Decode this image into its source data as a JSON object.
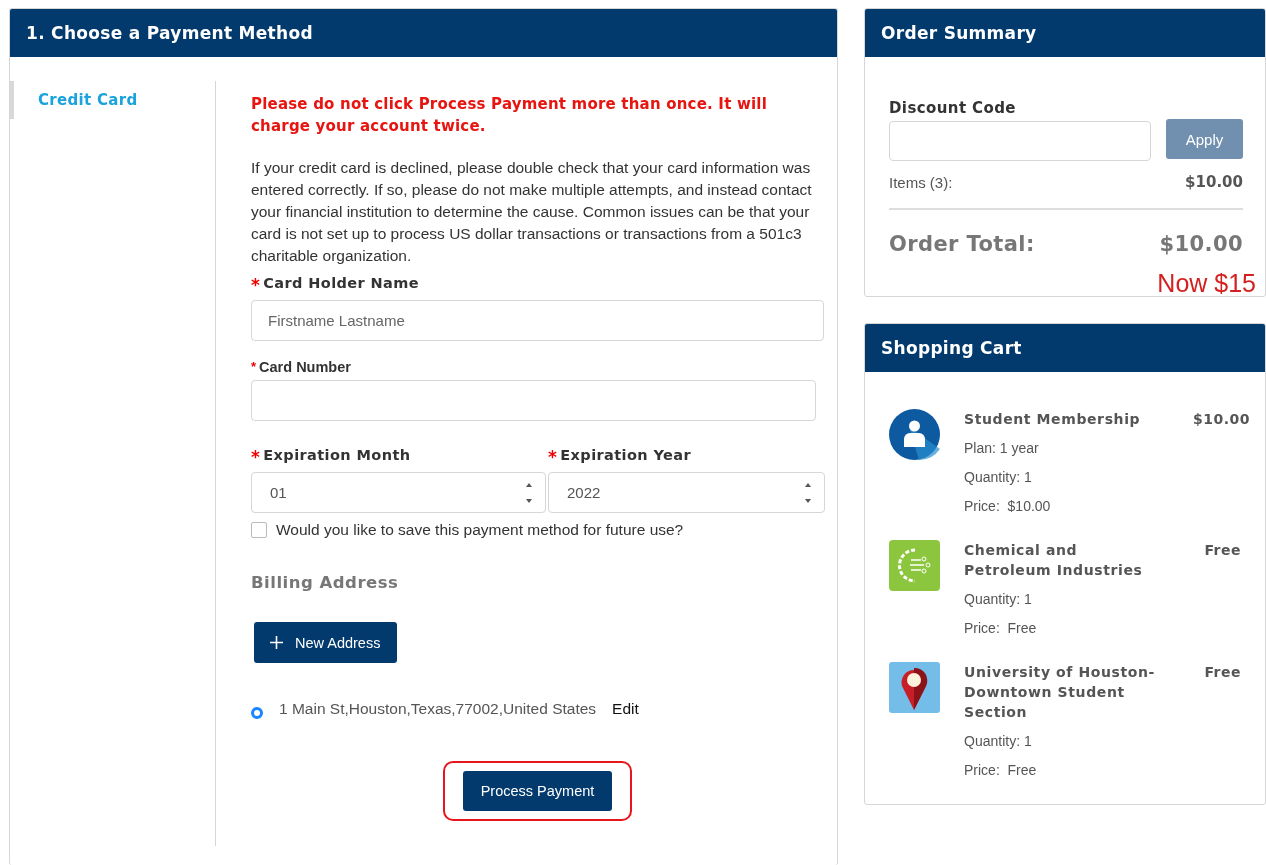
{
  "payment": {
    "title": "1. Choose a Payment Method",
    "methods": [
      {
        "label": "Credit Card",
        "selected": true
      }
    ],
    "warning": "Please do not click Process Payment more than once. It will charge your account twice.",
    "note": "If your credit card is declined, please double check that your card information was entered correctly. If so, please do not make multiple attempts, and instead contact your financial institution to determine the cause. Common issues can be that your card is not set up to process US dollar transactions or transactions from a 501c3 charitable organization.",
    "fields": [
      {
        "kind": "text",
        "marker": "*",
        "label": "Card Holder Name",
        "placeholder": "Firstname Lastname"
      },
      {
        "kind": "text",
        "marker": "*",
        "label": "Card Number"
      }
    ],
    "expiry": [
      {
        "kind": "spin",
        "marker": "*",
        "label": "Expiration Month",
        "value": "01"
      },
      {
        "kind": "spin",
        "marker": "*",
        "label": "Expiration Year",
        "value": "2022"
      }
    ],
    "save_method": {
      "label": "Would you like to save this payment method for future use?",
      "checked": false
    },
    "billing": {
      "title": "Billing Address",
      "new_button": "New Address",
      "addresses": [
        {
          "text": "1 Main St,Houston,Texas,77002,United States",
          "edit": "Edit",
          "selected": true
        }
      ]
    },
    "submit": {
      "label": "Process Payment",
      "highlighted": true
    }
  },
  "order_summary": {
    "title": "Order Summary",
    "discount_label": "Discount Code",
    "apply": "Apply",
    "items_label": "Items (3):",
    "items_value": "$10.00",
    "total_label": "Order Total:",
    "total_value": "$10.00",
    "annotation": "Now $15"
  },
  "cart": {
    "title": "Shopping Cart",
    "items": [
      {
        "name": "Student Membership",
        "price": "$10.00",
        "details": [
          "Plan: 1 year",
          "Quantity: 1",
          "Price:  $10.00"
        ]
      },
      {
        "name": "Chemical and Petroleum Industries",
        "price": "Free",
        "details": [
          "Quantity: 1",
          "Price:  Free"
        ]
      },
      {
        "name": "University of Houston-Downtown Student Section",
        "price": "Free",
        "details": [
          "Quantity: 1",
          "Price:  Free"
        ]
      }
    ]
  }
}
